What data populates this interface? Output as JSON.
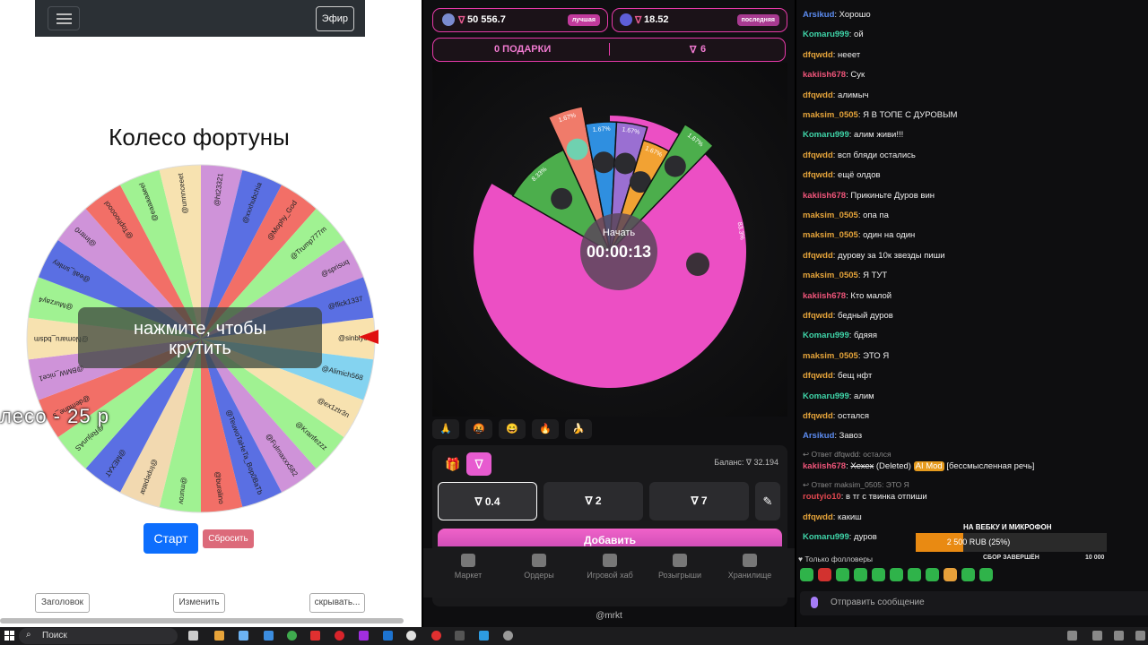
{
  "left": {
    "navbar": {
      "efir_label": "Эфир"
    },
    "wheel": {
      "title": "Колесо фортуны",
      "overlay_line1": "нажмите, чтобы",
      "overlay_line2": "крутить",
      "caption": "лесо - 25 р",
      "segments": [
        "@sinblye",
        "@Alimich568",
        "@ex1ztr3n",
        "@Kranfezzz",
        "@Fulmaxxx582",
        "@TeuwoTaHeTa_Bop0BaTb",
        "@buralino",
        "@murov",
        "@Inpepatar",
        "@MEXAT",
        "@RejunAS",
        "@demune_s",
        "@BMW_nice1",
        "@Nomaru_bdsm",
        "@Murzay4",
        "@eali_smley",
        "@lmtrr0",
        "@Tophoooool",
        "@eaaaaaeel",
        "@unnnceeet",
        "@ht23321",
        "@xxxhubchia",
        "@Mophy_God",
        "@Trump777m",
        "@sprisuq",
        "@flick1337"
      ],
      "colors": [
        "#f9e2ae",
        "#84d3f0",
        "#f7e2b0",
        "#a0f292",
        "#cf93d9",
        "#5a6fe3",
        "#f26f67",
        "#a0f292",
        "#f2d9b0",
        "#5a6fe3",
        "#a0f292",
        "#f26f67",
        "#cf93d9",
        "#f7e2b0",
        "#a0f292",
        "#5a6fe3",
        "#cf93d9",
        "#f26f67",
        "#a0f292",
        "#f7e2b0",
        "#cf93d9",
        "#5a6fe3",
        "#f26f67",
        "#a0f292",
        "#cf93d9",
        "#5a6fe3"
      ]
    },
    "buttons": {
      "start": "Старт",
      "reset": "Сбросить",
      "header": "Заголовок",
      "change": "Изменить",
      "hide": "скрывать..."
    }
  },
  "mid": {
    "best": {
      "value": "50 556.7",
      "badge": "лучшая"
    },
    "last": {
      "value": "18.52",
      "badge": "последняя"
    },
    "gifts": {
      "label": "0 ПОДАРКИ",
      "count": "6"
    },
    "spin": {
      "start": "Начать",
      "timer": "00:00:13"
    },
    "slices": [
      {
        "pct": "83.3%",
        "value": 83.3,
        "color": "#ec4fc4"
      },
      {
        "pct": "8.33%",
        "value": 8.33,
        "color": "#4cae4c"
      },
      {
        "pct": "1.67%",
        "value": 1.67,
        "color": "#f07b6a"
      },
      {
        "pct": "1.67%",
        "value": 1.67,
        "color": "#2f8fe0"
      },
      {
        "pct": "1.67%",
        "value": 1.67,
        "color": "#9a6fd2"
      },
      {
        "pct": "1.67%",
        "value": 1.67,
        "color": "#f2a233"
      },
      {
        "pct": "1.67%",
        "value": 1.67,
        "color": "#4cae4c"
      }
    ],
    "emojis": [
      "🙏",
      "🤬",
      "😄",
      "🔥",
      "🍌"
    ],
    "balance": "Баланс: ∇ 32.194",
    "bets": [
      "∇ 0.4",
      "∇ 2",
      "∇ 7"
    ],
    "add_label": "Добавить",
    "nav": [
      "Маркет",
      "Ордеры",
      "Игровой хаб",
      "Розыгрыши",
      "Хранилище"
    ],
    "footer": "@mrkt"
  },
  "chat": {
    "messages": [
      {
        "user": "Arsikud",
        "color": "#5b8bf0",
        "text": "Хорошо"
      },
      {
        "user": "Komaru999",
        "color": "#3fd4a8",
        "text": "ой"
      },
      {
        "user": "dfqwdd",
        "color": "#e4a33a",
        "text": "нееет"
      },
      {
        "user": "kakiish678",
        "color": "#f0557a",
        "text": "Сук"
      },
      {
        "user": "dfqwdd",
        "color": "#e4a33a",
        "text": "алимыч"
      },
      {
        "user": "maksim_0505",
        "color": "#e4a33a",
        "text": "Я В ТОПЕ С ДУРОВЫМ"
      },
      {
        "user": "Komaru999",
        "color": "#3fd4a8",
        "text": "алим живи!!!"
      },
      {
        "user": "dfqwdd",
        "color": "#e4a33a",
        "text": "всп бляди остались"
      },
      {
        "user": "dfqwdd",
        "color": "#e4a33a",
        "text": "ещё олдов"
      },
      {
        "user": "kakiish678",
        "color": "#f0557a",
        "text": "Прикиньте Дуров вин"
      },
      {
        "user": "maksim_0505",
        "color": "#e4a33a",
        "text": "опа па"
      },
      {
        "user": "maksim_0505",
        "color": "#e4a33a",
        "text": "один на один"
      },
      {
        "user": "dfqwdd",
        "color": "#e4a33a",
        "text": "дурову за 10к звезды пиши"
      },
      {
        "user": "maksim_0505",
        "color": "#e4a33a",
        "text": "Я ТУТ"
      },
      {
        "user": "kakiish678",
        "color": "#f0557a",
        "text": "Кто малой"
      },
      {
        "user": "dfqwdd",
        "color": "#e4a33a",
        "text": "бедный дуров"
      },
      {
        "user": "Komaru999",
        "color": "#3fd4a8",
        "text": "бдяяя"
      },
      {
        "user": "maksim_0505",
        "color": "#e4a33a",
        "text": "ЭТО Я"
      },
      {
        "user": "dfqwdd",
        "color": "#e4a33a",
        "text": "бещ нфт"
      },
      {
        "user": "Komaru999",
        "color": "#3fd4a8",
        "text": "алим"
      },
      {
        "user": "dfqwdd",
        "color": "#e4a33a",
        "text": "остался"
      },
      {
        "user": "Arsikud",
        "color": "#5b8bf0",
        "text": "Завоз"
      }
    ],
    "reply1": {
      "ref": "↩ Ответ dfqwdd: остался",
      "user": "kakiish678",
      "deleted": "Хехех",
      "deleted_tag": "(Deleted)",
      "mod": "AI Mod",
      "note": "[бессмысленная речь]"
    },
    "reply2": {
      "ref": "↩ Ответ maksim_0505: ЭТО Я",
      "user": "routyio10",
      "text": "в тг с твинка отпиши"
    },
    "after": [
      {
        "user": "dfqwdd",
        "color": "#e4a33a",
        "text": "какиш"
      },
      {
        "user": "Komaru999",
        "color": "#3fd4a8",
        "text": "дуров"
      }
    ],
    "goal": {
      "title": "НА ВЕБКУ И МИКРОФОН",
      "text": "2 500 RUB (25%)",
      "percent": 25,
      "done": "СБОР ЗАВЕРШЁН",
      "target": "10 000"
    },
    "followers": "♥ Только фолловеры",
    "input_placeholder": "Отправить сообщение"
  },
  "taskbar": {
    "search": "Поиск"
  }
}
